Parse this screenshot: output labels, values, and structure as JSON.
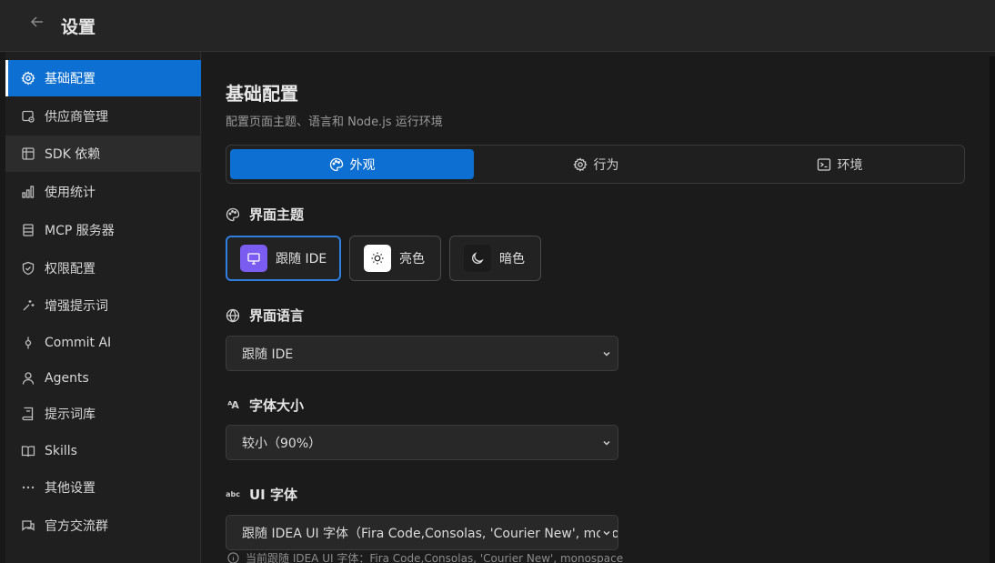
{
  "header": {
    "title": "设置"
  },
  "sidebar": {
    "items": [
      {
        "label": "基础配置",
        "icon": "gear-icon"
      },
      {
        "label": "供应商管理",
        "icon": "provider-icon"
      },
      {
        "label": "SDK 依赖",
        "icon": "package-icon"
      },
      {
        "label": "使用统计",
        "icon": "bar-chart-icon"
      },
      {
        "label": "MCP 服务器",
        "icon": "server-icon"
      },
      {
        "label": "权限配置",
        "icon": "shield-icon"
      },
      {
        "label": "增强提示词",
        "icon": "sparkle-icon"
      },
      {
        "label": "Commit AI",
        "icon": "commit-icon"
      },
      {
        "label": "Agents",
        "icon": "user-icon"
      },
      {
        "label": "提示词库",
        "icon": "book-icon"
      },
      {
        "label": "Skills",
        "icon": "open-book-icon"
      },
      {
        "label": "其他设置",
        "icon": "ellipsis-icon"
      },
      {
        "label": "官方交流群",
        "icon": "chat-icon"
      }
    ]
  },
  "main": {
    "title": "基础配置",
    "subtitle": "配置页面主题、语言和 Node.js 运行环境",
    "tabs": [
      {
        "label": "外观",
        "icon": "palette-icon"
      },
      {
        "label": "行为",
        "icon": "gear-icon"
      },
      {
        "label": "环境",
        "icon": "terminal-icon"
      }
    ],
    "theme": {
      "label": "界面主题",
      "options": [
        {
          "label": "跟随 IDE",
          "icon": "monitor-icon"
        },
        {
          "label": "亮色",
          "icon": "sun-icon"
        },
        {
          "label": "暗色",
          "icon": "moon-icon"
        }
      ]
    },
    "language": {
      "label": "界面语言",
      "value": "跟随 IDE"
    },
    "font_size": {
      "label": "字体大小",
      "value": "较小（90%）"
    },
    "ui_font": {
      "label": "UI 字体",
      "value": "跟随 IDEA UI 字体（Fira Code,Consolas, 'Courier New', monospace）",
      "hint": "当前跟随 IDEA UI 字体：Fira Code,Consolas, 'Courier New', monospace"
    }
  },
  "colors": {
    "accent": "#0c6fd1",
    "theme_ide_swatch": "#7b5cf0"
  }
}
